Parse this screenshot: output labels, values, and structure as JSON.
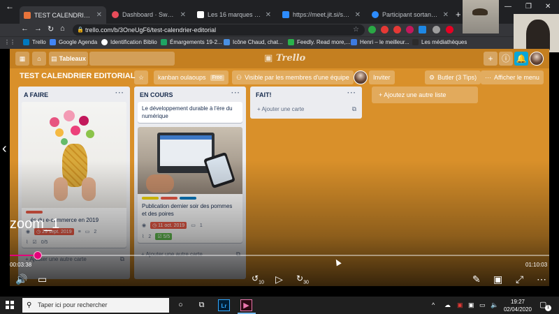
{
  "browser": {
    "tabs": [
      {
        "title": "TEST CALENDRIER EDITORIA",
        "active": true,
        "favicon_color": "#e8743b"
      },
      {
        "title": "Dashboard · Swello",
        "favicon_color": "#e84c5a"
      },
      {
        "title": "Les 16 marques auxquelle",
        "favicon_color": "#ffffff"
      },
      {
        "title": "https://meet.jit.si/static/clo",
        "favicon_color": "#2d8cff"
      },
      {
        "title": "Participant sortant de réuni",
        "favicon_color": "#2d8cff"
      }
    ],
    "url": "trello.com/b/3OneUgF6/test-calendrier-editorial",
    "bookmarks": [
      {
        "label": "Trello",
        "color": "#0079bf"
      },
      {
        "label": "Google Agenda",
        "color": "#4285f4"
      },
      {
        "label": "Identification Biblio",
        "color": "#ffffff"
      },
      {
        "label": "Émargements 19-2...",
        "color": "#1fa463"
      },
      {
        "label": "Icône Chaud, chat...",
        "color": "#4a90e2"
      },
      {
        "label": "Feedly. Read more,...",
        "color": "#2bb24c"
      },
      {
        "label": "Henri – le meilleur...",
        "color": "#3d7be0"
      },
      {
        "label": "Les médiathèques",
        "color": "#2b2b2b"
      }
    ]
  },
  "trello": {
    "logo": "Trello",
    "header_boards_label": "Tableaux",
    "board_title": "TEST CALENDRIER EDITORIAL",
    "team_label": "kanban oulaoups",
    "free_badge": "Free",
    "visibility_label": "Visible par les membres d'une équipe",
    "invite_label": "Inviter",
    "butler_label": "Butler (3 Tips)",
    "menu_label": "Afficher le menu",
    "add_list_label": "Ajoutez une autre liste",
    "lists": [
      {
        "title": "A FAIRE",
        "card_title": "...és du e-commerce en 2019",
        "due": "29 sept. 2019",
        "comments": "2",
        "checklist": "0/5",
        "add_card": "Ajouter une autre carte"
      },
      {
        "title": "EN COURS",
        "card1_text": "Le développement durable à l'ère du numérique",
        "card2_text": "Publication dernier soir des pommes et des poires",
        "due": "11 oct. 2019",
        "comments": "1",
        "attachments": "2",
        "checklist": "5/5",
        "add_card": "Ajouter une autre carte"
      },
      {
        "title": "FAIT!",
        "add_card": "Ajouter une carte"
      }
    ]
  },
  "video": {
    "label": "zoom_1",
    "elapsed": "00:03:38",
    "total": "01:10:03",
    "progress": 0.052,
    "skip_back": "10",
    "skip_forward": "30"
  },
  "taskbar": {
    "search_placeholder": "Taper ici pour rechercher",
    "time": "19:27",
    "date": "02/04/2020",
    "notifications": "1"
  },
  "colors": {
    "board_bg": "#d9902a",
    "label_red": "#eb5a46",
    "label_orange": "#ff9f1a",
    "label_blue": "#0079bf",
    "label_yellow": "#f2d600",
    "seek_accent": "#e3007a"
  }
}
